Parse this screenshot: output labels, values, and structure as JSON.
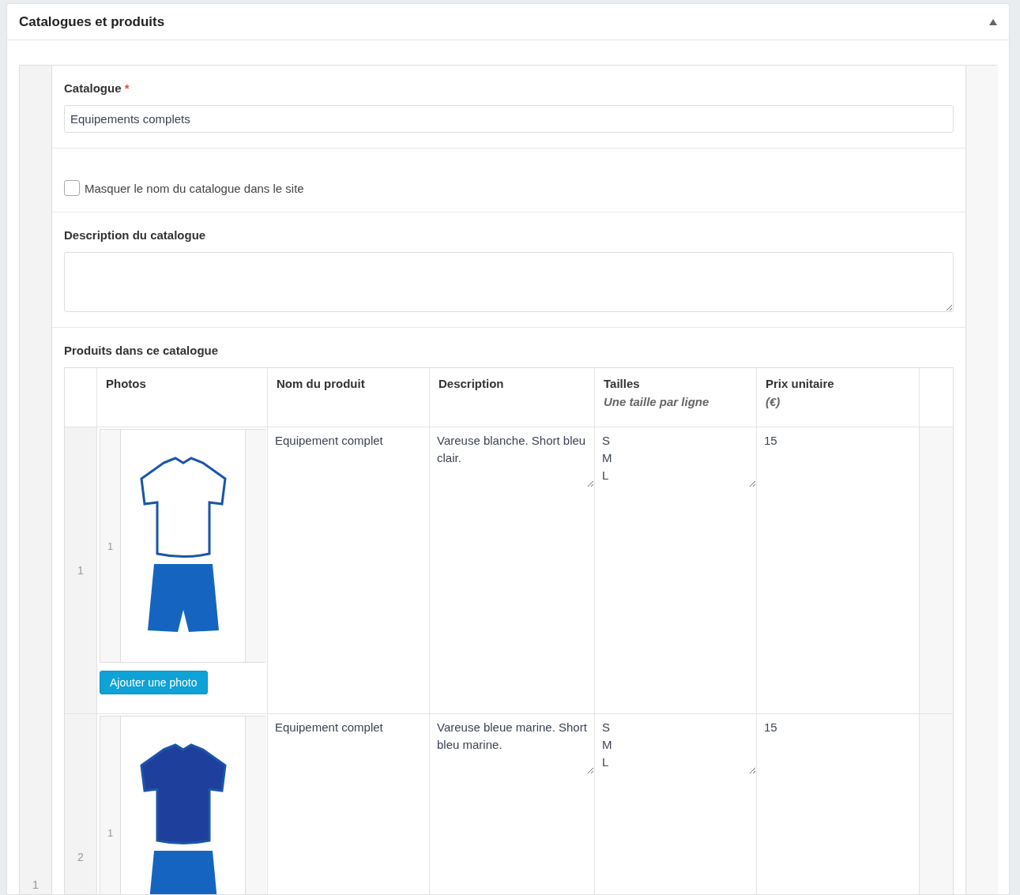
{
  "panel": {
    "title": "Catalogues et produits",
    "collapsed": false
  },
  "catalogues": [
    {
      "index": "1",
      "catalogue_label": "Catalogue",
      "required_mark": "*",
      "catalogue_value": "Equipements complets",
      "hide_name": {
        "label": "Masquer le nom du catalogue dans le site",
        "checked": false
      },
      "description_label": "Description du catalogue",
      "products_label": "Produits dans ce catalogue",
      "table": {
        "columns": [
          {
            "title": "Photos"
          },
          {
            "title": "Nom du produit"
          },
          {
            "title": "Description"
          },
          {
            "title": "Tailles",
            "hint": "Une taille par ligne"
          },
          {
            "title": "Prix unitaire",
            "hint": "(€)"
          }
        ],
        "rows": [
          {
            "index": "1",
            "photos": [
              {
                "index": "1",
                "color": "#ffffff"
              }
            ],
            "add_photo": "Ajouter une photo",
            "name": "Equipement complet",
            "description": "Vareuse blanche. Short bleu clair.",
            "sizes": "S\nM\nL",
            "price": "15"
          },
          {
            "index": "2",
            "photos": [
              {
                "index": "1",
                "color": "#1f3f9c"
              }
            ],
            "name": "Equipement complet",
            "description": "Vareuse bleue marine. Short bleu marine.",
            "sizes": "S\nM\nL",
            "price": "15"
          }
        ]
      }
    }
  ]
}
